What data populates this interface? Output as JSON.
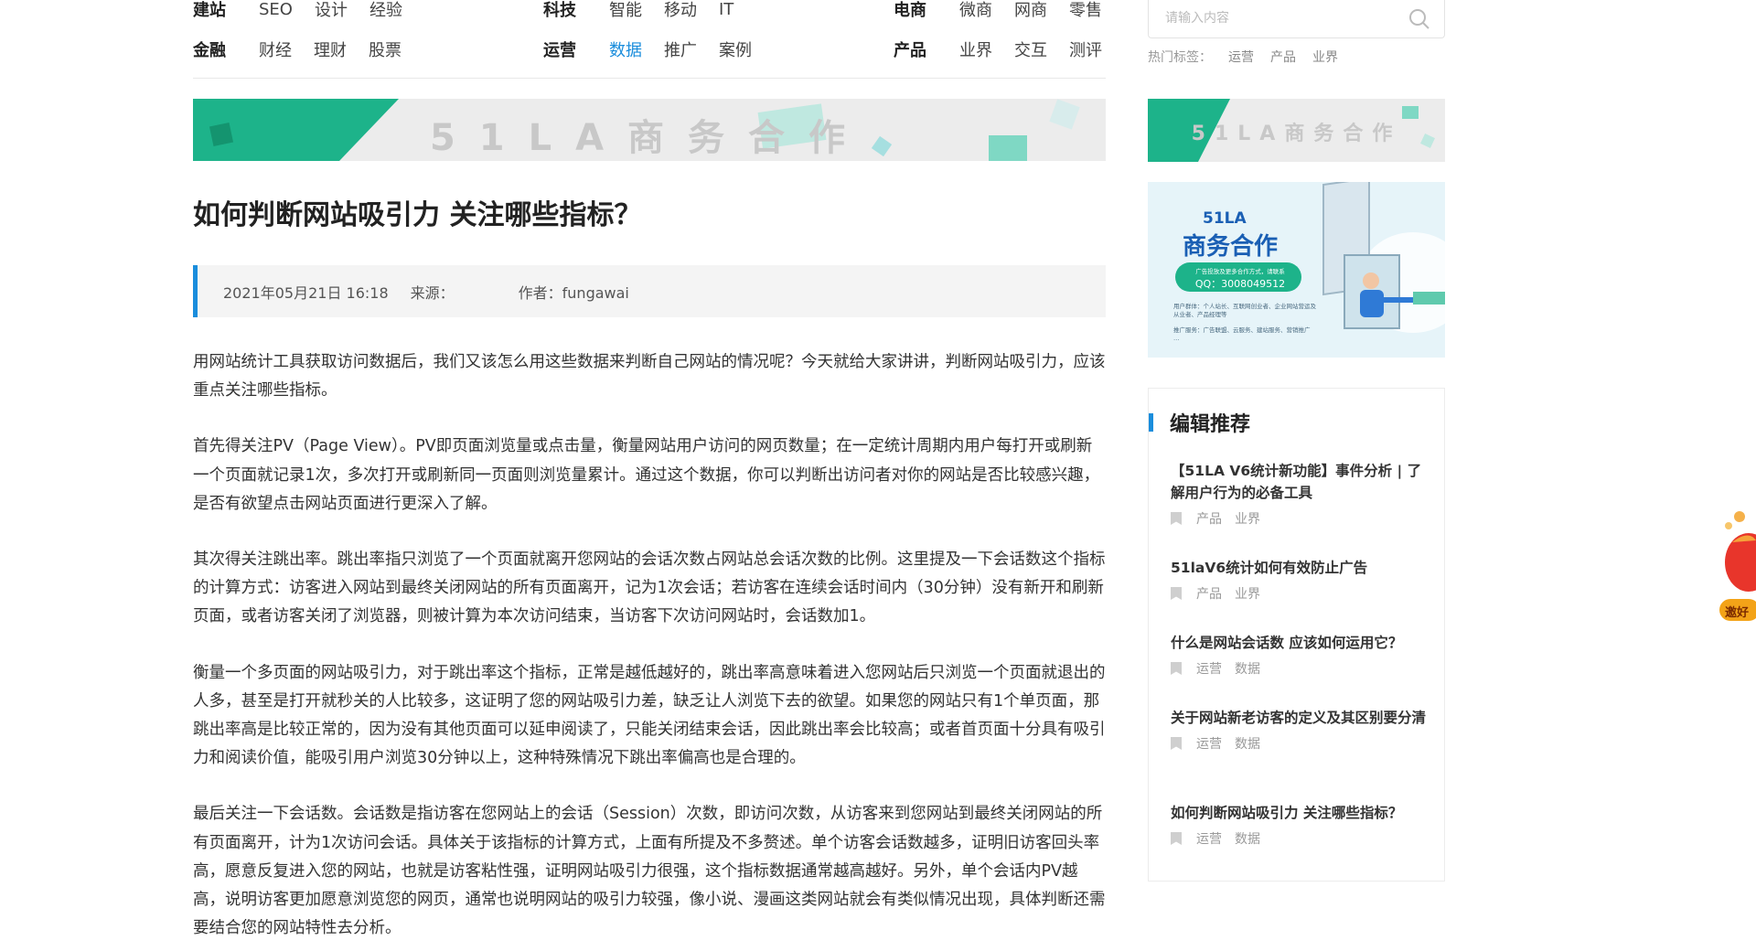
{
  "nav": {
    "groups": [
      {
        "rows": [
          {
            "head": "建站",
            "items": [
              "SEO",
              "设计",
              "经验"
            ]
          },
          {
            "head": "金融",
            "items": [
              "财经",
              "理财",
              "股票"
            ]
          }
        ]
      },
      {
        "rows": [
          {
            "head": "科技",
            "items": [
              "智能",
              "移动",
              "IT"
            ]
          },
          {
            "head": "运营",
            "items": [
              "数据",
              "推广",
              "案例"
            ]
          }
        ]
      },
      {
        "rows": [
          {
            "head": "电商",
            "items": [
              "微商",
              "网商",
              "零售"
            ]
          },
          {
            "head": "产品",
            "items": [
              "业界",
              "交互",
              "测评"
            ]
          }
        ]
      }
    ],
    "active_item": "数据"
  },
  "search": {
    "placeholder": "请输入内容",
    "hot_label": "热门标签：",
    "hot_tags": [
      "运营",
      "产品",
      "业界"
    ]
  },
  "banners": {
    "main_text": "51LA商务合作",
    "side_text": "51LA商务合作",
    "ad_title_1": "51LA",
    "ad_title_2": "商务合作",
    "ad_qq": "QQ：3008049512",
    "ad_pill_top": "广告投放及更多合作方式，请联系",
    "ad_line_1": "用户群体：个人站长、互联网创业者、企业网站营运及从业者、产品经理等",
    "ad_line_2": "推广服务：广告联盟、云服务、建站服务、营销推广 …"
  },
  "article": {
    "title": "如何判断网站吸引力 关注哪些指标？",
    "date": "2021年05月21日 16:18",
    "source": "来源：",
    "author": "作者：fungawai",
    "paragraphs": [
      "用网站统计工具获取访问数据后，我们又该怎么用这些数据来判断自己网站的情况呢？今天就给大家讲讲，判断网站吸引力，应该重点关注哪些指标。",
      "首先得关注PV（Page View）。PV即页面浏览量或点击量，衡量网站用户访问的网页数量；在一定统计周期内用户每打开或刷新一个页面就记录1次，多次打开或刷新同一页面则浏览量累计。通过这个数据，你可以判断出访问者对你的网站是否比较感兴趣，是否有欲望点击网站页面进行更深入了解。",
      "其次得关注跳出率。跳出率指只浏览了一个页面就离开您网站的会话次数占网站总会话次数的比例。这里提及一下会话数这个指标的计算方式：访客进入网站到最终关闭网站的所有页面离开，记为1次会话；若访客在连续会话时间内（30分钟）没有新开和刷新页面，或者访客关闭了浏览器，则被计算为本次访问结束，当访客下次访问网站时，会话数加1。",
      "衡量一个多页面的网站吸引力，对于跳出率这个指标，正常是越低越好的，跳出率高意味着进入您网站后只浏览一个页面就退出的人多，甚至是打开就秒关的人比较多，这证明了您的网站吸引力差，缺乏让人浏览下去的欲望。如果您的网站只有1个单页面，那跳出率高是比较正常的，因为没有其他页面可以延申阅读了，只能关闭结束会话，因此跳出率会比较高；或者首页面十分具有吸引力和阅读价值，能吸引用户浏览30分钟以上，这种特殊情况下跳出率偏高也是合理的。",
      "最后关注一下会话数。会话数是指访客在您网站上的会话（Session）次数，即访问次数，从访客来到您网站到最终关闭网站的所有页面离开，计为1次访问会话。具体关于该指标的计算方式，上面有所提及不多赘述。单个访客会话数越多，证明旧访客回头率高，愿意反复进入您的网站，也就是访客粘性强，证明网站吸引力很强，这个指标数据通常越高越好。另外，单个会话内PV越高，说明访客更加愿意浏览您的网页，通常也说明网站的吸引力较强，像小说、漫画这类网站就会有类似情况出现，具体判断还需要结合您的网站特性去分析。"
    ]
  },
  "recommend": {
    "heading": "编辑推荐",
    "items": [
      {
        "title": "【51LA V6统计新功能】事件分析 | 了解用户行为的必备工具",
        "tags": [
          "产品",
          "业界"
        ]
      },
      {
        "title": "51laV6统计如何有效防止广告",
        "tags": [
          "产品",
          "业界"
        ]
      },
      {
        "title": "什么是网站会话数 应该如何运用它？",
        "tags": [
          "运营",
          "数据"
        ]
      },
      {
        "title": "关于网站新老访客的定义及其区别要分清",
        "tags": [
          "运营",
          "数据"
        ]
      },
      {
        "title": "如何判断网站吸引力 关注哪些指标？",
        "tags": [
          "运营",
          "数据"
        ]
      }
    ]
  },
  "float_widget": {
    "label": "邀好"
  },
  "colors": {
    "accent": "#1a8ddc",
    "banner_green": "#1db38a",
    "banner_gray": "#ececec"
  }
}
